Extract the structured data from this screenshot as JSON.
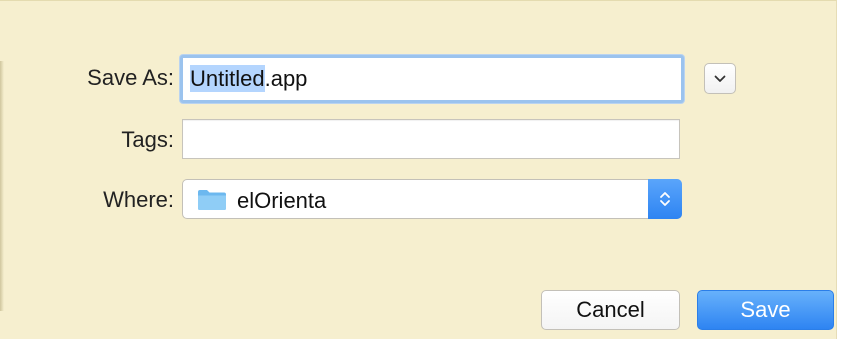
{
  "dialog": {
    "save_as_label": "Save As:",
    "filename": {
      "selected": "Untitled",
      "extension": ".app"
    },
    "tags_label": "Tags:",
    "tags_value": "",
    "where_label": "Where:",
    "where_value": "elOrienta",
    "cancel_label": "Cancel",
    "save_label": "Save"
  },
  "icons": {
    "expand": "chevron-down-icon",
    "folder": "folder-icon",
    "stepper": "up-down-chevron-icon"
  },
  "colors": {
    "sheet_background": "#f6efcf",
    "selection": "#b4d5fe",
    "accent_blue": "#2e84f2",
    "focus_ring": "#9bc3ee"
  }
}
